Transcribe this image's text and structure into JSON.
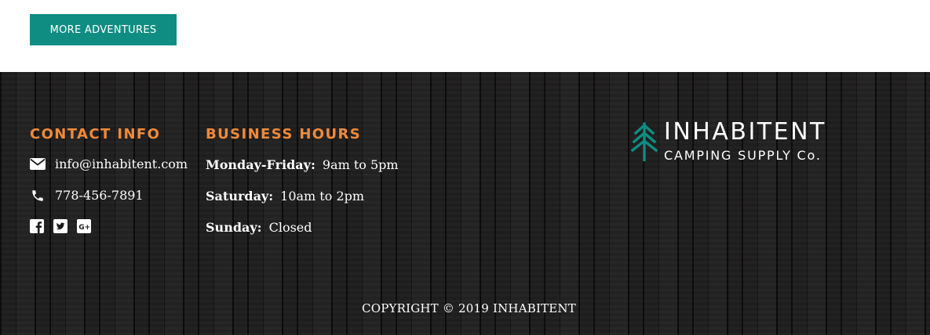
{
  "cta": {
    "more_label": "MORE ADVENTURES"
  },
  "contact": {
    "heading": "CONTACT INFO",
    "email": "info@inhabitent.com",
    "phone": "778-456-7891",
    "social_icons": [
      "facebook-icon",
      "twitter-icon",
      "google-plus-icon"
    ]
  },
  "hours": {
    "heading": "BUSINESS HOURS",
    "rows": [
      {
        "day": "Monday-Friday:",
        "time": "9am to 5pm"
      },
      {
        "day": "Saturday:",
        "time": "10am to 2pm"
      },
      {
        "day": "Sunday:",
        "time": "Closed"
      }
    ]
  },
  "brand": {
    "name": "INHABITENT",
    "tagline": "CAMPING SUPPLY Co.",
    "logo_icon": "pine-tree-icon"
  },
  "footer": {
    "copyright": "COPYRIGHT © 2019 INHABITENT"
  },
  "colors": {
    "accent_teal": "#0f8d83",
    "heading_orange": "#f08a3a",
    "footer_bg": "#1c1b1b",
    "text_white": "#ffffff"
  }
}
